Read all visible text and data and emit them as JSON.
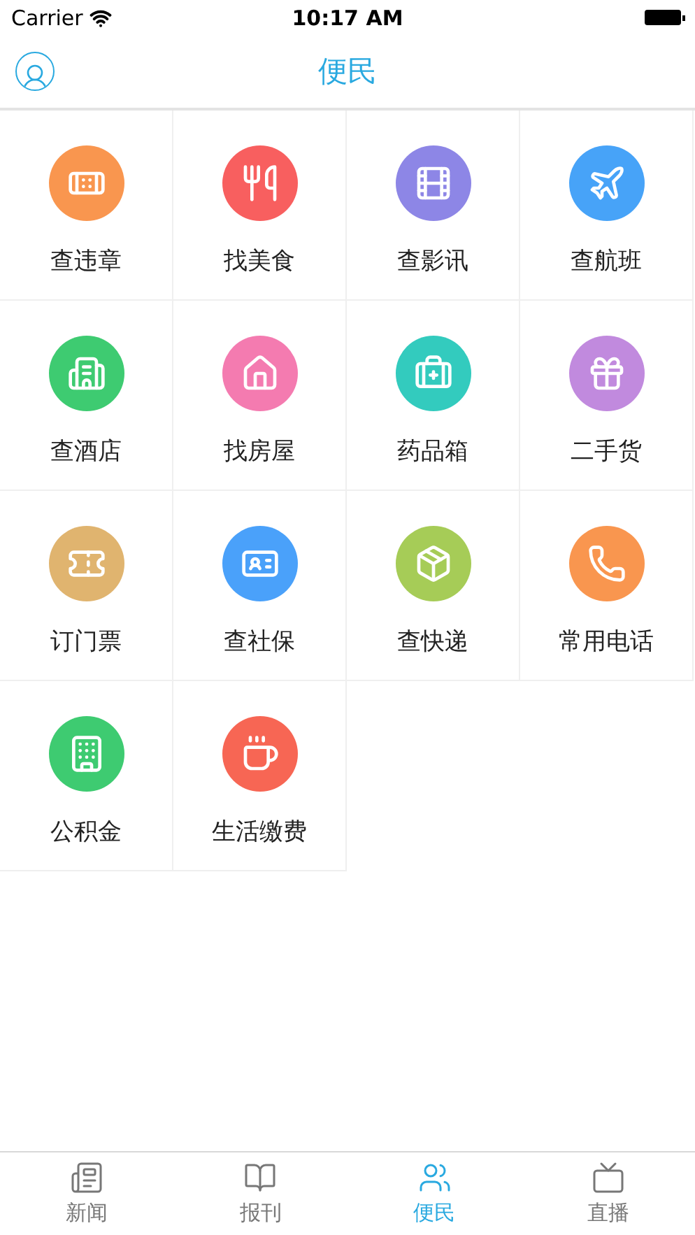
{
  "status_bar": {
    "carrier": "Carrier",
    "time": "10:17 AM"
  },
  "nav": {
    "title": "便民"
  },
  "services": [
    {
      "label": "查违章",
      "color": "#f9964f"
    },
    {
      "label": "找美食",
      "color": "#f85f5f"
    },
    {
      "label": "查影讯",
      "color": "#8d86e6"
    },
    {
      "label": "查航班",
      "color": "#47a3f8"
    },
    {
      "label": "查酒店",
      "color": "#3ecb71"
    },
    {
      "label": "找房屋",
      "color": "#f47bb0"
    },
    {
      "label": "药品箱",
      "color": "#33cbbe"
    },
    {
      "label": "二手货",
      "color": "#c18ade"
    },
    {
      "label": "订门票",
      "color": "#e0b46f"
    },
    {
      "label": "查社保",
      "color": "#4aa1fa"
    },
    {
      "label": "查快递",
      "color": "#a6cc57"
    },
    {
      "label": "常用电话",
      "color": "#f9964f"
    },
    {
      "label": "公积金",
      "color": "#3ecb71"
    },
    {
      "label": "生活缴费",
      "color": "#f76654"
    }
  ],
  "tabs": [
    {
      "label": "新闻",
      "selected": false
    },
    {
      "label": "报刊",
      "selected": false
    },
    {
      "label": "便民",
      "selected": true
    },
    {
      "label": "直播",
      "selected": false
    }
  ]
}
